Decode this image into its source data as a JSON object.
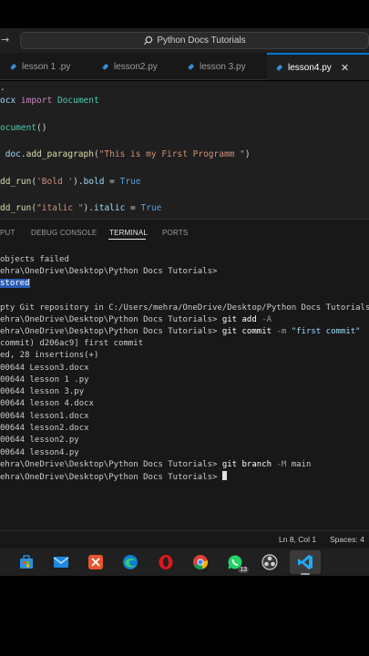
{
  "titlebar": {
    "search_text": "Python Docs Tutorials"
  },
  "tabs": [
    {
      "label": "lesson 1 .py"
    },
    {
      "label": "lesson2.py"
    },
    {
      "label": "lesson 3.py"
    },
    {
      "label": "lesson4.py"
    }
  ],
  "editor": {
    "line1": ".",
    "line2_a": "ocx ",
    "line2_b": "import",
    "line2_c": " Document",
    "line3_a": "ocument",
    "line3_b": "()",
    "line4_a": " doc.",
    "line4_b": "add_paragraph",
    "line4_c": "(",
    "line4_d": "\"This is my First Programm \"",
    "line4_e": ")",
    "line5_a": "dd_run",
    "line5_b": "(",
    "line5_c": "'Bold '",
    "line5_d": ").",
    "line5_e": "bold",
    "line5_f": " = ",
    "line5_g": "True",
    "line6_a": "dd_run",
    "line6_b": "(",
    "line6_c": "\"italic \"",
    "line6_d": ").",
    "line6_e": "italic",
    "line6_f": " = ",
    "line6_g": "True"
  },
  "panel": {
    "tabs": [
      "PUT",
      "DEBUG CONSOLE",
      "TERMINAL",
      "PORTS"
    ]
  },
  "terminal": {
    "l1": "objects failed",
    "l2": "ehra\\OneDrive\\Desktop\\Python Docs Tutorials>",
    "l3": "stored",
    "l4": "pty Git repository in C:/Users/mehra/OneDrive/Desktop/Python Docs Tutorials/",
    "l5_prompt": "ehra\\OneDrive\\Desktop\\Python Docs Tutorials> ",
    "l5_git": "git add",
    "l5_opt": " -A",
    "l6_prompt": "ehra\\OneDrive\\Desktop\\Python Docs Tutorials> ",
    "l6_git": "git commit",
    "l6_opt": " -m ",
    "l6_str": "\"first commit\"",
    "l7": "commit) d206ac9] first commit",
    "l8": "ed, 28 insertions(+)",
    "l9": "00644 Lesson3.docx",
    "l10": "00644 lesson 1 .py",
    "l11": "00644 lesson 3.py",
    "l12": "00644 lesson 4.docx",
    "l13": "00644 lesson1.docx",
    "l14": "00644 lesson2.docx",
    "l15": "00644 lesson2.py",
    "l16": "00644 lesson4.py",
    "l17_prompt": "ehra\\OneDrive\\Desktop\\Python Docs Tutorials> ",
    "l17_git": "git branch",
    "l17_opt": " -M ",
    "l17_arg": "main",
    "l18_prompt": "ehra\\OneDrive\\Desktop\\Python Docs Tutorials> "
  },
  "statusbar": {
    "position": "Ln 8, Col 1",
    "spaces": "Spaces: 4"
  },
  "taskbar": {
    "icons": [
      "store-icon",
      "mail-icon",
      "office-icon",
      "edge-icon",
      "opera-icon",
      "chrome-icon",
      "whatsapp-icon",
      "obs-icon",
      "vscode-icon"
    ],
    "whatsapp_badge": "13"
  },
  "colors": {
    "accent": "#0078d4",
    "keyword": "#c586c0",
    "function": "#dcdcaa",
    "string": "#ce9178",
    "selection": "#2b5cb8"
  }
}
